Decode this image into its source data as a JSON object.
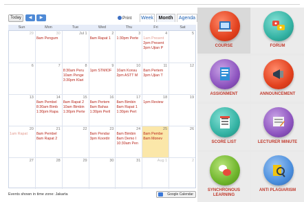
{
  "calendar": {
    "today_label": "Today",
    "prev_icon": "◀",
    "next_icon": "▶",
    "print_label": "Print",
    "tabs": [
      "Week",
      "Month",
      "Agenda"
    ],
    "weekdays": [
      "Sun",
      "Mon",
      "Tue",
      "Wed",
      "Thu",
      "Fri",
      "Sat"
    ],
    "weeks": [
      [
        {
          "day": "29",
          "other": true,
          "events": []
        },
        {
          "day": "30",
          "other": true,
          "events": [
            {
              "text": "8am Pengum"
            }
          ]
        },
        {
          "day": "Jul 1",
          "events": []
        },
        {
          "day": "2",
          "events": [
            {
              "text": "8am Rapat 1"
            }
          ]
        },
        {
          "day": "3",
          "events": [
            {
              "text": "1:30pm Perte"
            }
          ]
        },
        {
          "day": "4",
          "events": [
            {
              "text": "1am Present",
              "faint": true
            },
            {
              "text": "2pm Present"
            },
            {
              "text": "3pm Ujian P"
            }
          ]
        },
        {
          "day": "5",
          "events": []
        }
      ],
      [
        {
          "day": "6",
          "events": []
        },
        {
          "day": "7",
          "events": []
        },
        {
          "day": "8",
          "events": [
            {
              "text": "8:30am Peru"
            },
            {
              "text": "10am Penge"
            },
            {
              "text": "3:30pm Klari"
            }
          ]
        },
        {
          "day": "9",
          "events": [
            {
              "text": "1pm STMIOF"
            }
          ]
        },
        {
          "day": "10",
          "events": [
            {
              "text": "10am Konsu"
            },
            {
              "text": "2pm ASTT M"
            }
          ]
        },
        {
          "day": "11",
          "events": [
            {
              "text": "8am Pertem"
            },
            {
              "text": "3pm Ujian T"
            }
          ]
        },
        {
          "day": "12",
          "events": []
        }
      ],
      [
        {
          "day": "13",
          "events": []
        },
        {
          "day": "14",
          "events": [
            {
              "text": "8am Pembel"
            },
            {
              "text": "8:30am Bimb"
            },
            {
              "text": "1:30pm Rapa"
            }
          ]
        },
        {
          "day": "15",
          "events": [
            {
              "text": "8am Rapat 2"
            },
            {
              "text": "10am Bimbin"
            },
            {
              "text": "1:30pm Perte"
            }
          ]
        },
        {
          "day": "16",
          "events": [
            {
              "text": "8am Pertem"
            },
            {
              "text": "8am Bahas"
            },
            {
              "text": "1:30pm Peril"
            }
          ]
        },
        {
          "day": "17",
          "events": [
            {
              "text": "8am Bimbin"
            },
            {
              "text": "8am Rapat 1"
            },
            {
              "text": "1:30pm Pert"
            }
          ]
        },
        {
          "day": "18",
          "events": [
            {
              "text": "1pm Review"
            }
          ]
        },
        {
          "day": "19",
          "events": []
        }
      ],
      [
        {
          "day": "20",
          "events": [
            {
              "text": "1am Rapat",
              "faint": true
            }
          ]
        },
        {
          "day": "21",
          "events": [
            {
              "text": "8am Pembel"
            },
            {
              "text": "8am Rapat 2"
            }
          ]
        },
        {
          "day": "22",
          "events": []
        },
        {
          "day": "23",
          "events": [
            {
              "text": "8am Pendar"
            },
            {
              "text": "3pm Koordir"
            }
          ]
        },
        {
          "day": "24",
          "events": [
            {
              "text": "8am Bimbin"
            },
            {
              "text": "8am Demo I"
            },
            {
              "text": "10:30am Pen"
            }
          ]
        },
        {
          "day": "25",
          "today": true,
          "events": [
            {
              "text": "8am Pembe"
            },
            {
              "text": "8am Monev"
            }
          ]
        },
        {
          "day": "26",
          "events": []
        }
      ],
      [
        {
          "day": "27",
          "events": []
        },
        {
          "day": "28",
          "events": []
        },
        {
          "day": "29",
          "events": []
        },
        {
          "day": "30",
          "events": []
        },
        {
          "day": "31",
          "events": []
        },
        {
          "day": "Aug 1",
          "other": true,
          "events": []
        },
        {
          "day": "2",
          "other": true,
          "events": []
        }
      ]
    ],
    "timezone_note": "Events shown in time zone: Jakarta",
    "gcal_label": "Google Calendar"
  },
  "modules": [
    {
      "label": "COURSE"
    },
    {
      "label": "FORUM"
    },
    {
      "label": "ASSIGNMENT"
    },
    {
      "label": "ANNOUNCEMENT"
    },
    {
      "label": "SCORE LIST"
    },
    {
      "label": "LECTURER MINUTE"
    },
    {
      "label_line1": "SYNCHRONOUS",
      "label_line2": "LEARNING"
    },
    {
      "label": "ANTI PLAGIARISM"
    }
  ]
}
